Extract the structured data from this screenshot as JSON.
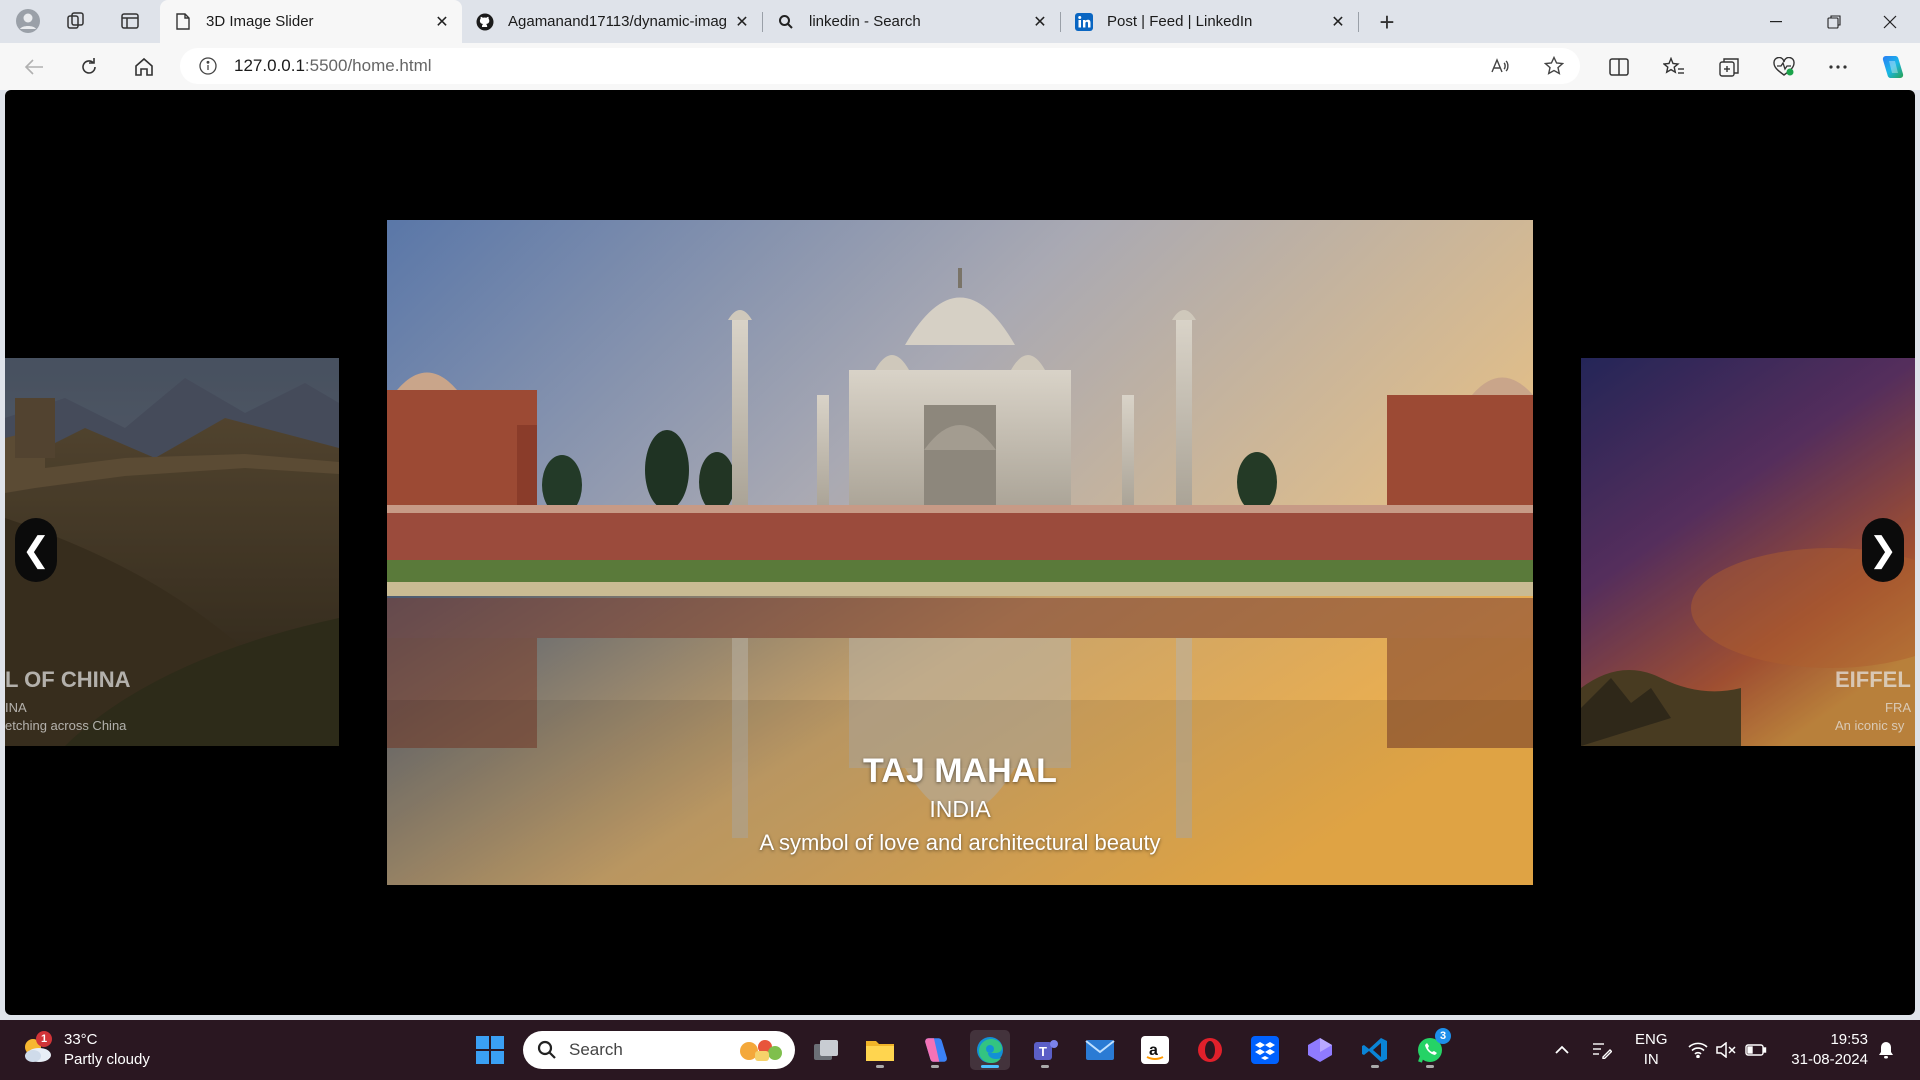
{
  "browser": {
    "tabs": [
      {
        "title": "3D Image Slider",
        "icon": "page-icon",
        "active": true
      },
      {
        "title": "Agamanand17113/dynamic-imag",
        "icon": "github-icon",
        "active": false
      },
      {
        "title": "linkedin - Search",
        "icon": "search-icon",
        "active": false
      },
      {
        "title": "Post | Feed | LinkedIn",
        "icon": "linkedin-icon",
        "active": false
      }
    ],
    "url_host": "127.0.0.1",
    "url_path": ":5500/home.html"
  },
  "slider": {
    "main": {
      "title": "TAJ MAHAL",
      "country": "INDIA",
      "description": "A symbol of love and architectural beauty"
    },
    "left": {
      "title": "L OF CHINA",
      "country": "INA",
      "description": "etching across China"
    },
    "right": {
      "title": "EIFFEL",
      "country": "FRA",
      "description": "An iconic sy"
    },
    "prev_label": "❮",
    "next_label": "❯"
  },
  "taskbar": {
    "weather_temp": "33°C",
    "weather_desc": "Partly cloudy",
    "weather_badge": "1",
    "search_label": "Search",
    "whatsapp_badge": "3",
    "lang_line1": "ENG",
    "lang_line2": "IN",
    "time": "19:53",
    "date": "31-08-2024"
  },
  "colors": {
    "page_bg": "#000000",
    "tabstrip_bg": "#dfe3ea",
    "taskbar_bg": "#2a1721",
    "accent": "#4cc2ff"
  }
}
